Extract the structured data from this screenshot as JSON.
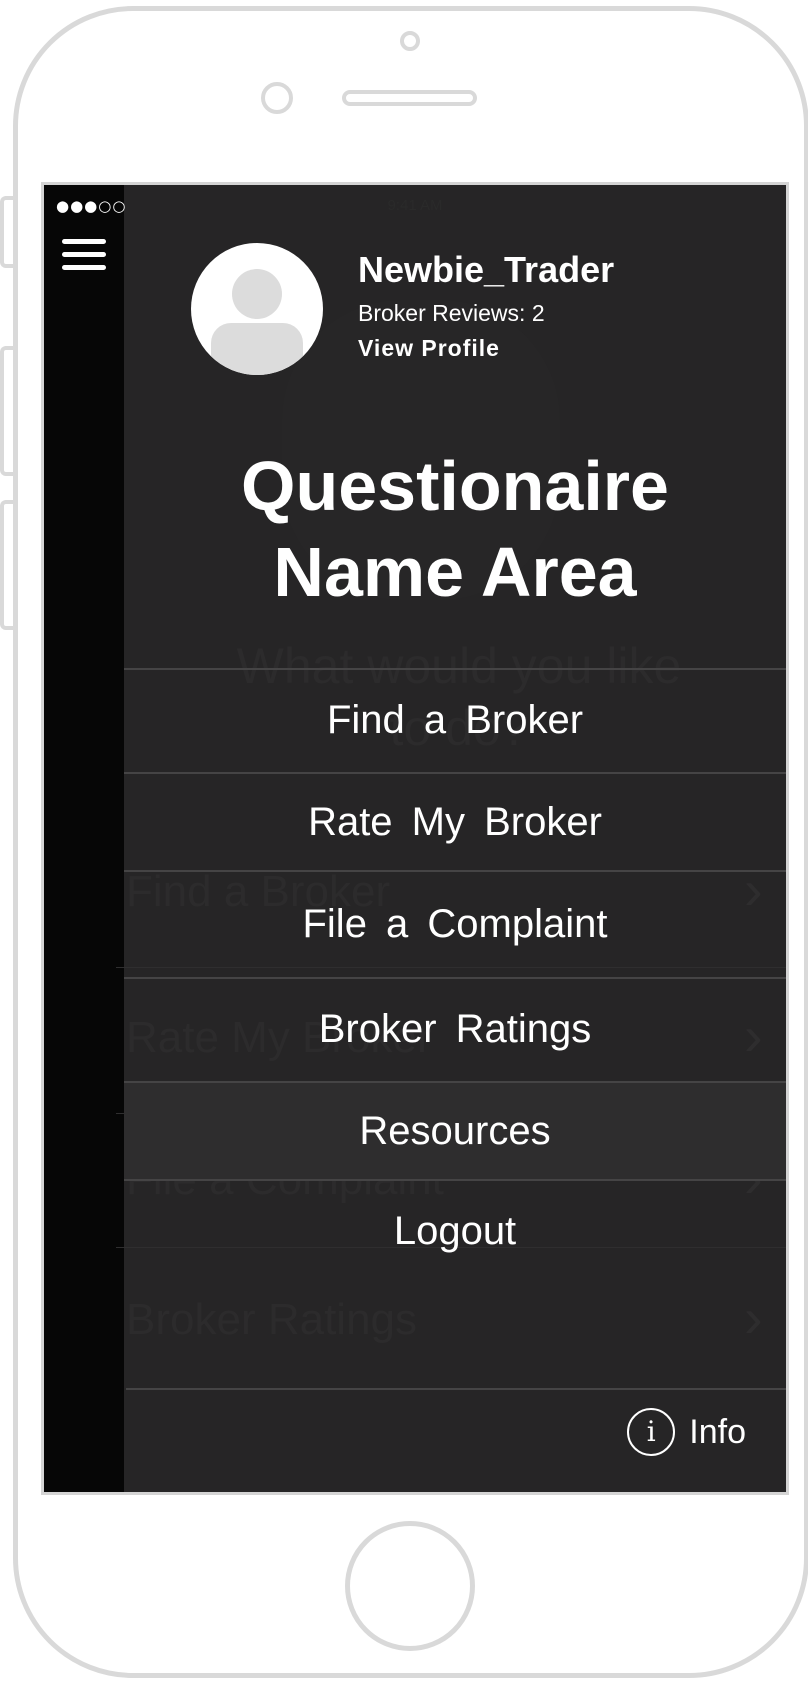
{
  "status_bar": {
    "signal": "●●●○○",
    "time": "9:41 AM"
  },
  "profile": {
    "username": "Newbie_Trader",
    "reviews": "Broker Reviews: 2",
    "view_profile": "View Profile"
  },
  "title": {
    "line1": "Questionaire",
    "line2": "Name Area"
  },
  "menu": [
    {
      "label": "Find a Broker"
    },
    {
      "label": "Rate My Broker"
    },
    {
      "label": "File a Complaint"
    },
    {
      "label": "Broker Ratings"
    },
    {
      "label": "Resources"
    },
    {
      "label": "Logout"
    }
  ],
  "background_page": {
    "question": "What would you like to do?",
    "items": [
      "Find a Broker",
      "Rate My Broker",
      "File a Complaint",
      "Broker Ratings"
    ]
  },
  "info": {
    "icon_glyph": "i",
    "label": "Info"
  },
  "colors": {
    "drawer_bg": "#262526",
    "screen_bg": "#060606",
    "text": "#ffffff",
    "divider": "#454445"
  },
  "icons": {
    "menu": "hamburger-icon",
    "avatar": "user-avatar-icon",
    "info": "info-circle-icon"
  }
}
